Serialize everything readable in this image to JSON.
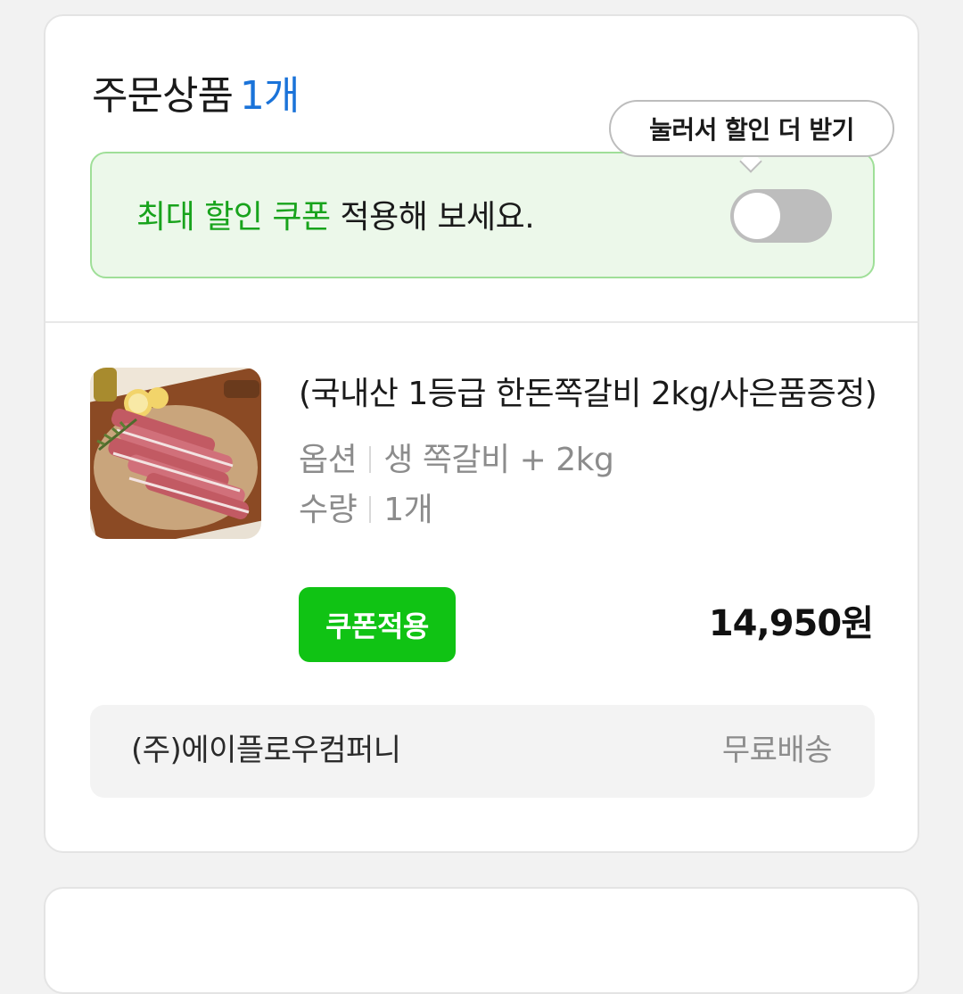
{
  "order": {
    "title": "주문상품",
    "count": "1개"
  },
  "coupon_banner": {
    "highlight": "최대 할인 쿠폰",
    "rest": " 적용해 보세요.",
    "tooltip": "눌러서 할인 더 받기",
    "toggle_on": false
  },
  "product": {
    "name": "(국내산 1등급 한돈쪽갈비 2kg/사은품증정)",
    "option_label": "옵션",
    "option_value": "생 쪽갈비 + 2kg",
    "quantity_label": "수량",
    "quantity_value": "1개",
    "coupon_button": "쿠폰적용",
    "price": "14,950원"
  },
  "seller": {
    "name": "(주)에이플로우컴퍼니",
    "shipping": "무료배송"
  },
  "colors": {
    "accent_blue": "#1a73d9",
    "accent_green": "#10c314",
    "banner_bg": "#ecf8ea"
  }
}
